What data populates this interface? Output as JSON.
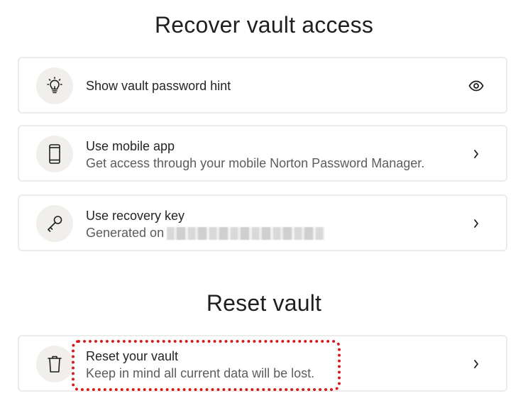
{
  "sections": {
    "recover_title": "Recover vault access",
    "reset_title": "Reset vault"
  },
  "cards": {
    "hint": {
      "title": "Show vault password hint",
      "icon": "lightbulb-icon",
      "trailing_icon": "eye-icon"
    },
    "mobile": {
      "title": "Use mobile app",
      "subtitle": "Get access through your mobile Norton Password Manager.",
      "icon": "phone-icon",
      "trailing_icon": "chevron-right-icon"
    },
    "recovery_key": {
      "title": "Use recovery key",
      "subtitle": "Generated on",
      "subtitle_value_redacted": true,
      "icon": "key-icon",
      "trailing_icon": "chevron-right-icon"
    },
    "reset": {
      "title": "Reset your vault",
      "subtitle": "Keep in mind all current data will be lost.",
      "icon": "trash-icon",
      "trailing_icon": "chevron-right-icon"
    }
  },
  "colors": {
    "highlight": "#d81c1c",
    "icon_bg": "#f1efec",
    "card_border": "#ececec"
  }
}
